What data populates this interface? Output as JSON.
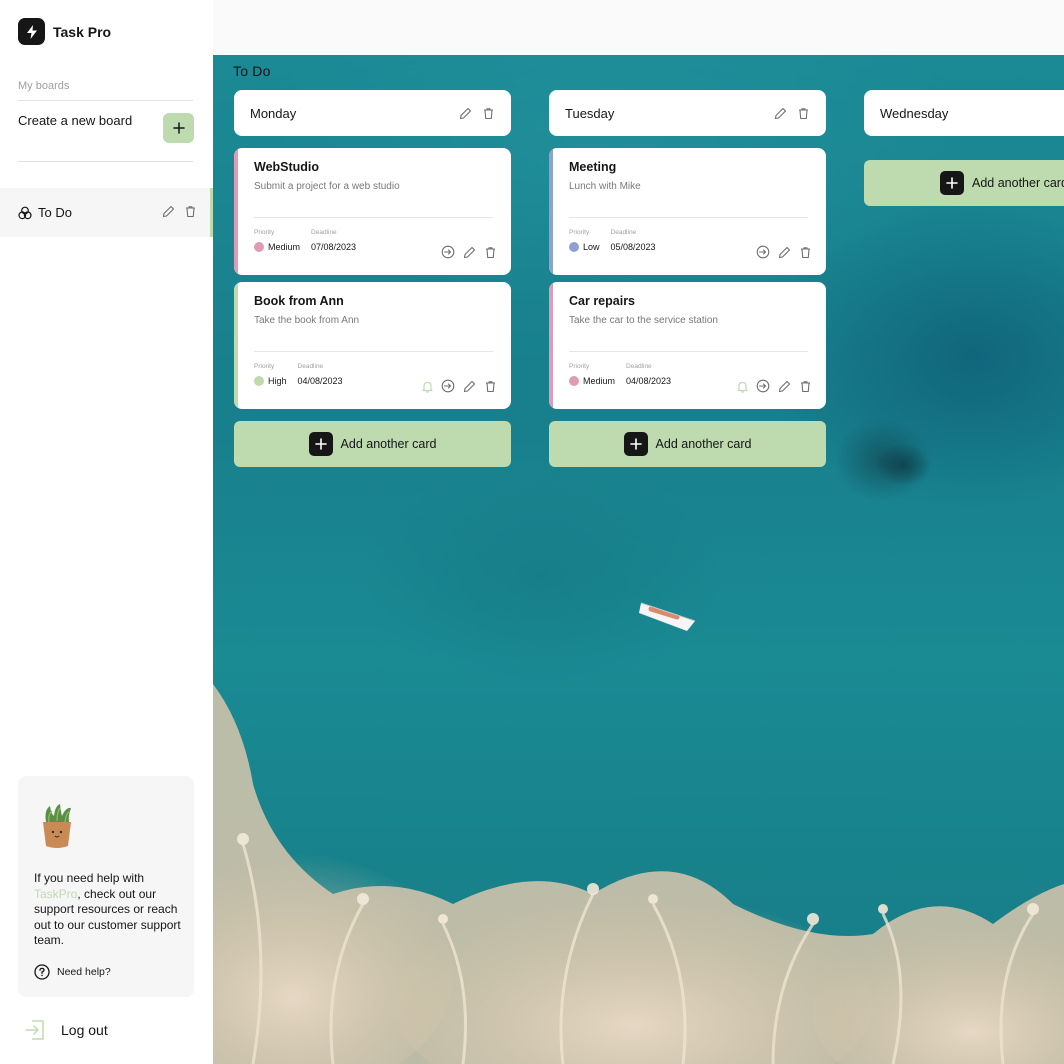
{
  "app": {
    "name": "Task Pro"
  },
  "sidebar": {
    "section_label": "My boards",
    "create_label": "Create a new board",
    "boards": [
      {
        "label": "To Do",
        "icon": "three-circles-icon"
      }
    ],
    "help": {
      "text_before": "If you need help with ",
      "brand": "TaskPro",
      "text_after": ", check out our support resources or reach out to our customer support team.",
      "link": "Need help?"
    },
    "logout": "Log out"
  },
  "board": {
    "title": "To Do",
    "columns": [
      {
        "title": "Monday",
        "cards": [
          {
            "title": "WebStudio",
            "description": "Submit a project for a web studio",
            "priority_label": "Priority",
            "priority": "Medium",
            "priority_color": "#e09cb5",
            "deadline_label": "Deadline",
            "deadline": "07/08/2023",
            "bell": false
          },
          {
            "title": "Book from Ann",
            "description": "Take the book from Ann",
            "priority_label": "Priority",
            "priority": "High",
            "priority_color": "#bedbb0",
            "deadline_label": "Deadline",
            "deadline": "04/08/2023",
            "bell": true
          }
        ],
        "add_label": "Add another card"
      },
      {
        "title": "Tuesday",
        "cards": [
          {
            "title": "Meeting",
            "description": "Lunch with Mike",
            "priority_label": "Priority",
            "priority": "Low",
            "priority_color": "#8fa1d0",
            "deadline_label": "Deadline",
            "deadline": "05/08/2023",
            "bell": false
          },
          {
            "title": "Car repairs",
            "description": "Take the car to the service station",
            "priority_label": "Priority",
            "priority": "Medium",
            "priority_color": "#e09cb5",
            "deadline_label": "Deadline",
            "deadline": "04/08/2023",
            "bell": true
          }
        ],
        "add_label": "Add another card"
      },
      {
        "title": "Wednesday",
        "cards": [],
        "add_label": "Add another card"
      }
    ]
  },
  "colors": {
    "accent": "#bedbb0",
    "dark": "#161616",
    "muted": "#a0a0a0"
  }
}
